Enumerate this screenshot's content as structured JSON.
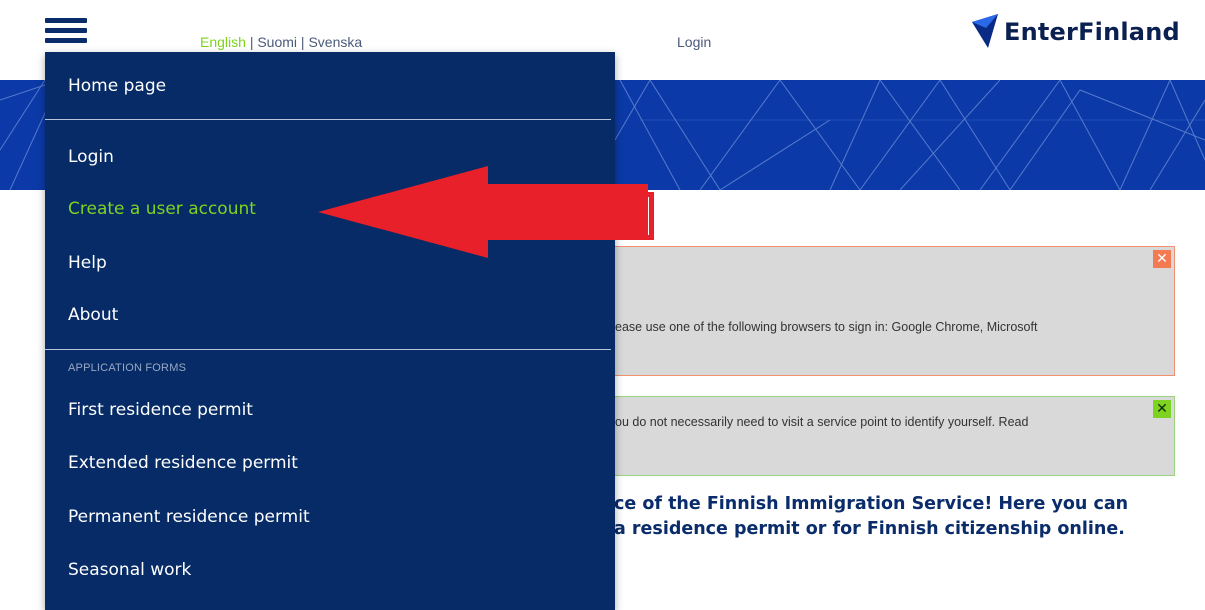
{
  "header": {
    "languages": [
      {
        "label": "English",
        "active": true
      },
      {
        "label": "Suomi",
        "active": false
      },
      {
        "label": "Svenska",
        "active": false
      }
    ],
    "separator": "|",
    "login_label": "Login",
    "logo_text": "EnterFinland"
  },
  "menu": {
    "items_top": [
      {
        "label": "Home page"
      }
    ],
    "items_account": [
      {
        "label": "Login"
      },
      {
        "label": "Create a user account"
      },
      {
        "label": "Help"
      },
      {
        "label": "About"
      }
    ],
    "section_title": "APPLICATION FORMS",
    "items_forms": [
      {
        "label": "First residence permit"
      },
      {
        "label": "Extended residence permit"
      },
      {
        "label": "Permanent residence permit"
      },
      {
        "label": "Seasonal work"
      }
    ]
  },
  "alerts": {
    "red_text": "ease use one of the following browsers to sign in: Google Chrome, Microsoft",
    "green_text": "ou do not necessarily need to visit a service point to identify yourself. Read",
    "close_glyph": "✕"
  },
  "welcome": {
    "line1": "ce of the Finnish Immigration Service! Here you can",
    "line2": "a residence permit or for Finnish citizenship online."
  },
  "colors": {
    "navy": "#062b66",
    "banner": "#0b3aa8",
    "accent_green": "#7ed321",
    "annotation_red": "#e8202a"
  }
}
